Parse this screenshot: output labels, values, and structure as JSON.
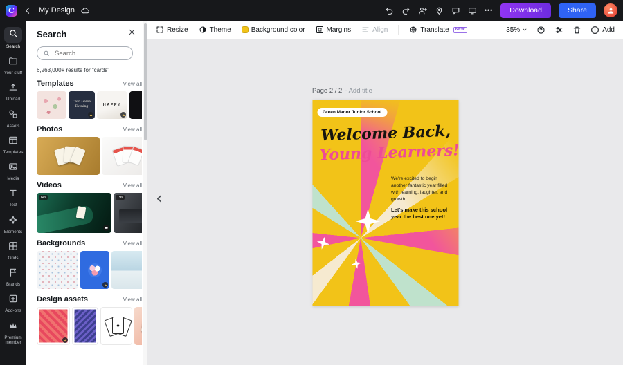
{
  "topbar": {
    "doc_title": "My Design",
    "ellipsis": "•••",
    "download": "Download",
    "share": "Share"
  },
  "rail": {
    "items": [
      {
        "label": "Search"
      },
      {
        "label": "Your stuff"
      },
      {
        "label": "Upload"
      },
      {
        "label": "Assets"
      },
      {
        "label": "Templates"
      },
      {
        "label": "Media"
      },
      {
        "label": "Text"
      },
      {
        "label": "Elements"
      },
      {
        "label": "Grids"
      },
      {
        "label": "Brands"
      },
      {
        "label": "Add-ons"
      },
      {
        "label": "Premium member"
      }
    ]
  },
  "panel": {
    "title": "Search",
    "search_placeholder": "Search",
    "results": "6,263,000+ results for \"cards\"",
    "view_all": "View all",
    "sections": {
      "templates": {
        "title": "Templates",
        "thumb2_text": "Card Game Evening",
        "thumb3_text": "HAPPY"
      },
      "photos": {
        "title": "Photos"
      },
      "videos": {
        "title": "Videos",
        "durations": [
          "14s",
          "19s"
        ]
      },
      "backgrounds": {
        "title": "Backgrounds"
      },
      "design_assets": {
        "title": "Design assets",
        "spade": "♠"
      }
    }
  },
  "toolbar": {
    "resize": "Resize",
    "theme": "Theme",
    "background_color": "Background color",
    "margins": "Margins",
    "align": "Align",
    "translate": "Translate",
    "new_badge": "NEW",
    "zoom": "35%",
    "add": "Add"
  },
  "canvas": {
    "page_indicator": "Page 2 / 2",
    "page_hint": "- Add title"
  },
  "poster": {
    "badge": "Green Manor Junior School",
    "headline1": "Welcome Back,",
    "headline2": "Young Learners!",
    "body": "We're excited to begin another fantastic year filled with learning, laughter, and growth.",
    "cta": "Let's make this school year the best one yet!",
    "colors": {
      "background": "#f2c318",
      "pink": "#f2559c",
      "cream": "#f6ead0",
      "mint": "#bfe2cc"
    }
  }
}
